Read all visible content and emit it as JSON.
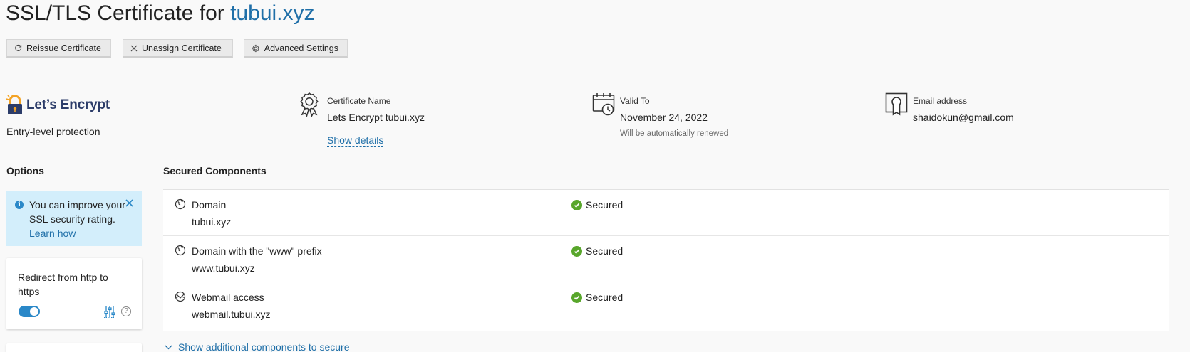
{
  "page": {
    "title_prefix": "SSL/TLS Certificate for ",
    "title_domain": "tubui.xyz"
  },
  "toolbar": {
    "reissue_label": "Reissue Certificate",
    "unassign_label": "Unassign Certificate",
    "advanced_label": "Advanced Settings"
  },
  "provider": {
    "name": "Let’s Encrypt",
    "protection": "Entry-level protection"
  },
  "certificate": {
    "name_label": "Certificate Name",
    "name_value": "Lets Encrypt tubui.xyz",
    "details_link": "Show details",
    "valid_label": "Valid To",
    "valid_value": "November 24, 2022",
    "valid_note": "Will be automatically renewed",
    "email_label": "Email address",
    "email_value": "shaidokun@gmail.com"
  },
  "options": {
    "heading": "Options",
    "tip_text": "You can improve your SSL security rating.",
    "tip_link": "Learn how",
    "redirect_label": "Redirect from http to https",
    "redirect_enabled": true,
    "help_glyph": "?"
  },
  "secured": {
    "heading": "Secured Components",
    "rows": [
      {
        "icon": "domain-icon",
        "name": "Domain",
        "sub": "tubui.xyz",
        "status": "Secured"
      },
      {
        "icon": "domain-icon",
        "name": "Domain with the \"www\" prefix",
        "sub": "www.tubui.xyz",
        "status": "Secured"
      },
      {
        "icon": "webmail-icon",
        "name": "Webmail access",
        "sub": "webmail.tubui.xyz",
        "status": "Secured"
      }
    ],
    "more_link": "Show additional components to secure"
  },
  "colors": {
    "accent": "#1f6fa8",
    "success": "#58a62b",
    "tip_bg": "#d3eefb",
    "toggle_on": "#2a88c8"
  }
}
